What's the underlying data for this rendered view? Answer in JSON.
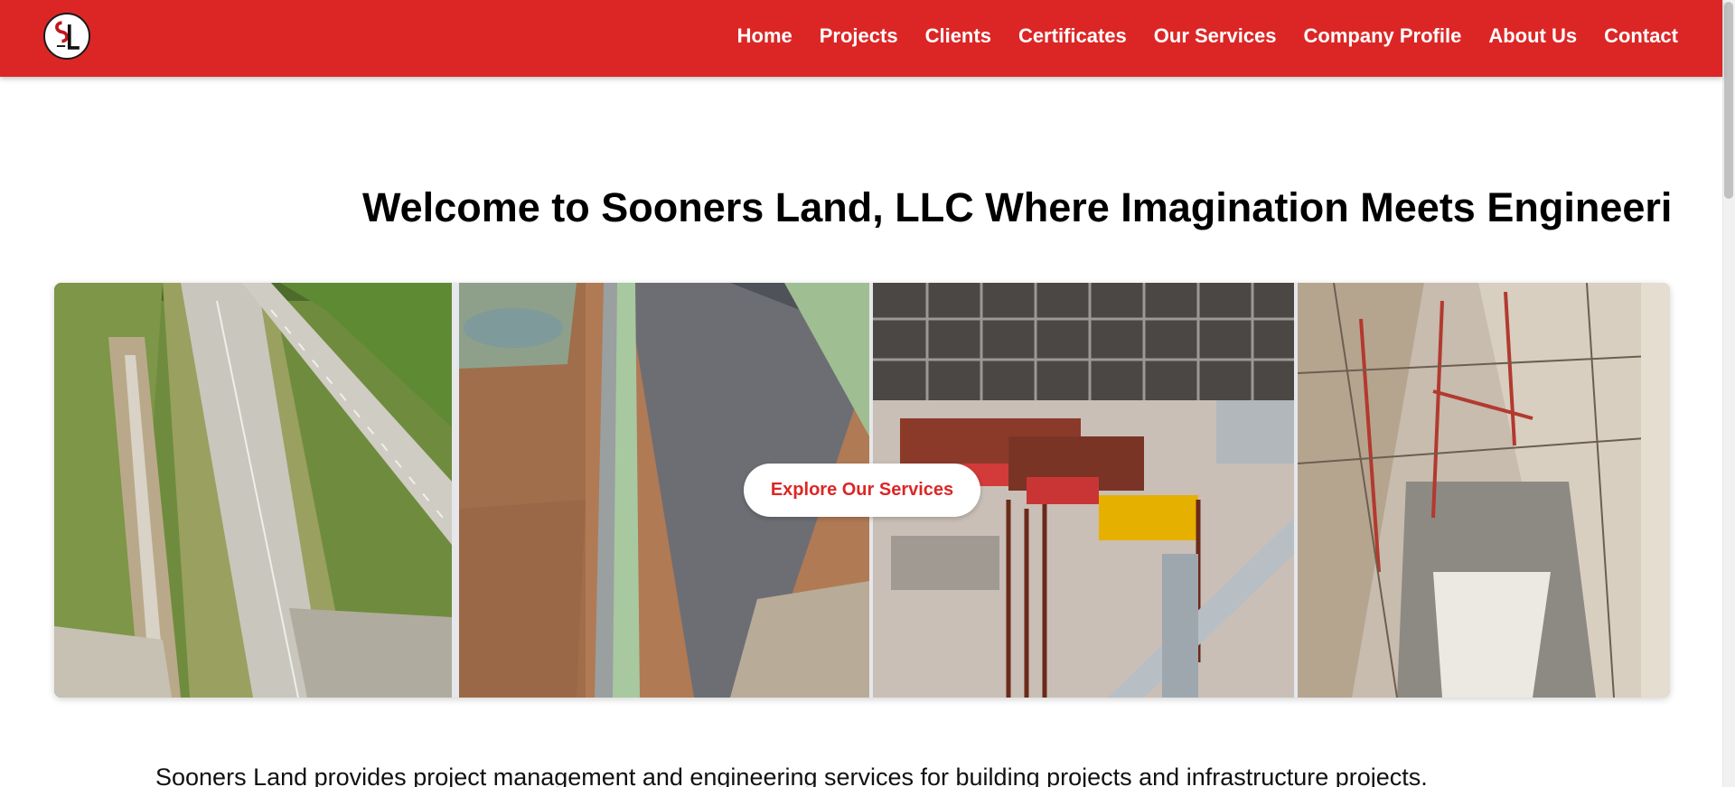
{
  "header": {
    "logo_text": "SL",
    "nav": [
      {
        "label": "Home"
      },
      {
        "label": "Projects"
      },
      {
        "label": "Clients"
      },
      {
        "label": "Certificates"
      },
      {
        "label": "Our Services"
      },
      {
        "label": "Company Profile"
      },
      {
        "label": "About Us"
      },
      {
        "label": "Contact"
      }
    ]
  },
  "hero": {
    "title": "Welcome to Sooners Land, LLC Where Imagination Meets Engineeri",
    "cta_label": "Explore Our Services"
  },
  "intro": {
    "text": "Sooners Land provides project management and engineering services for building projects and infrastructure projects."
  },
  "colors": {
    "brand_red": "#dc2626",
    "cta_text": "#dc2626",
    "nav_text": "#ffffff"
  },
  "icons": {
    "logo": "sl-monogram-logo"
  }
}
